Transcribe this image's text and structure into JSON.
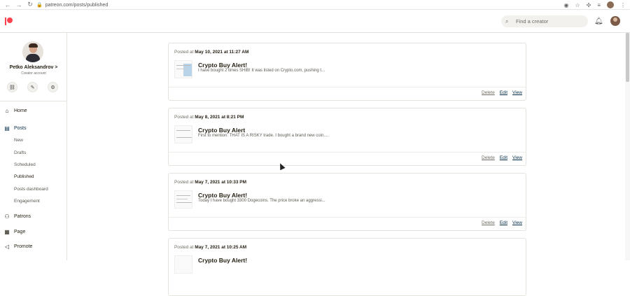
{
  "browser": {
    "url": "patreon.com/posts/published",
    "back_icon": "arrow-left-icon",
    "forward_icon": "arrow-right-icon",
    "reload_icon": "reload-icon"
  },
  "header": {
    "search_placeholder": "Find a creator"
  },
  "profile": {
    "name": "Petko Aleksandrov >",
    "subtitle": "Creator account"
  },
  "nav": {
    "home": "Home",
    "posts": "Posts",
    "posts_sub": [
      "New",
      "Drafts",
      "Scheduled",
      "Published",
      "Posts dashboard",
      "Engagement"
    ],
    "patrons": "Patrons",
    "page": "Page",
    "promote": "Promote"
  },
  "posts": [
    {
      "prefix": "Posted at ",
      "date": "May 10, 2021 at 11:27 AM",
      "title": "Crypto Buy Alert!",
      "excerpt": "I have bought 2 times SHIB! It was listed on Crypto.com, pushing t...",
      "delete": "Delete",
      "edit": "Edit",
      "view": "View"
    },
    {
      "prefix": "Posted at ",
      "date": "May 8, 2021 at 8:21 PM",
      "title": "Crypto Buy Alert",
      "excerpt": "First to mention: THAT IS A RISKY trade. I bought a brand new coin....",
      "delete": "Delete",
      "edit": "Edit",
      "view": "View"
    },
    {
      "prefix": "Posted at ",
      "date": "May 7, 2021 at 10:33 PM",
      "title": "Crypto Buy Alert!",
      "excerpt": "Today I have bought 3300 Dogecoins. The price broke an aggressi...",
      "delete": "Delete",
      "edit": "Edit",
      "view": "View"
    },
    {
      "prefix": "Posted at ",
      "date": "May 7, 2021 at 10:25 AM",
      "title": "Crypto Buy Alert!",
      "excerpt": "",
      "delete": "",
      "edit": "",
      "view": ""
    }
  ],
  "colors": {
    "brand": "#ff424d",
    "link": "#052d49"
  }
}
